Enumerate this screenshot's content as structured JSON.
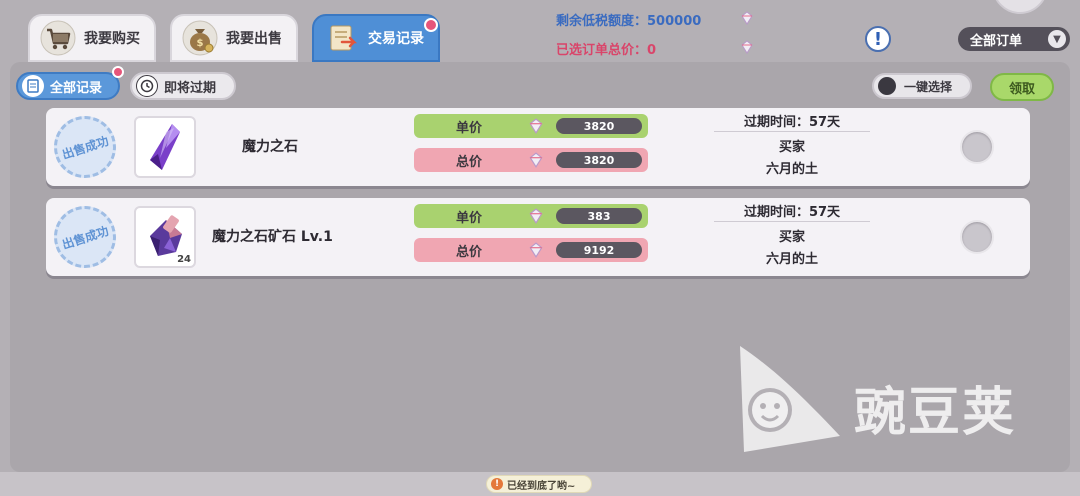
{
  "tabs": [
    {
      "label": "我要购买"
    },
    {
      "label": "我要出售"
    },
    {
      "label": "交易记录"
    }
  ],
  "header": {
    "tax_label": "剩余低税额度：",
    "tax_value": "500000",
    "selected_total_label": "已选订单总价：",
    "selected_total_value": "0",
    "order_filter": "全部订单",
    "alert_symbol": "!"
  },
  "subtabs": {
    "all_records": "全部记录",
    "expiring": "即将过期"
  },
  "actions": {
    "one_key_select": "一键选择",
    "claim": "领取"
  },
  "records": [
    {
      "stamp": "出售成功",
      "item_name": "魔力之石",
      "item_qty": "",
      "unit_label": "单价",
      "unit_price": "3820",
      "total_label": "总价",
      "total_price": "3820",
      "expire": "过期时间：57天",
      "buyer_label": "买家",
      "buyer_name": "六月的土"
    },
    {
      "stamp": "出售成功",
      "item_name": "魔力之石矿石 Lv.1",
      "item_qty": "24",
      "unit_label": "单价",
      "unit_price": "383",
      "total_label": "总价",
      "total_price": "9192",
      "expire": "过期时间：57天",
      "buyer_label": "买家",
      "buyer_name": "六月的土"
    }
  ],
  "footer": {
    "end_text": "已经到底了哟~",
    "warn_symbol": "!"
  },
  "watermark": {
    "text": "豌豆荚"
  },
  "colors": {
    "active_tab": "#4f8fd6",
    "unit_price_bg": "#a9d26f",
    "total_price_bg": "#f0a6b2",
    "tax_text": "#3a6bc0",
    "selected_total_text": "#d9456a",
    "claim_bg": "#a9d86a"
  }
}
